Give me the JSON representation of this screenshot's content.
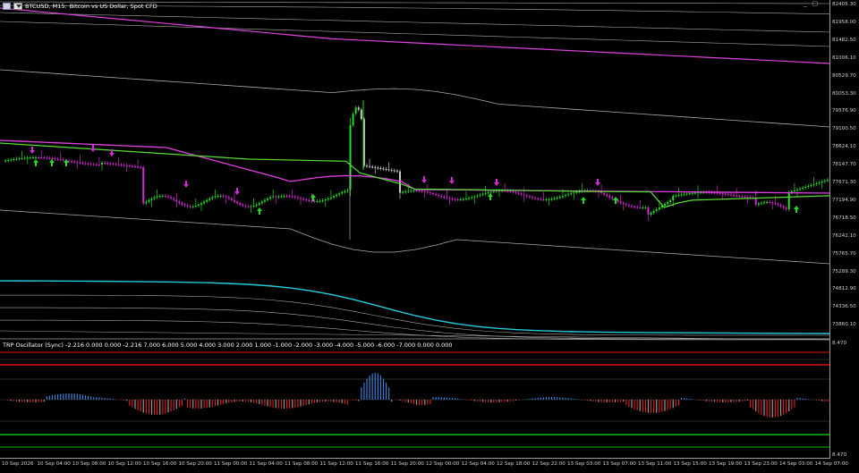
{
  "header": {
    "symbol_timeframe": "BTCUSD, M15:",
    "description": "Bitcoin vs US Dollar, Spot CFD"
  },
  "oscillator_header": {
    "text": "TRP Oscillator (Sync) -2.216 0.000 0.000 -2.216 7.000 6.000 5.000 4.000 3.000 2.000 1.000 -1.000 -2.000 -3.000 -4.000 -5.000 -6.000 -7.000 0.000 0.000"
  },
  "price_axis": [
    "82405.30",
    "81958.00",
    "81482.50",
    "81006.10",
    "80529.70",
    "80053.30",
    "79576.90",
    "79100.50",
    "78624.10",
    "78147.70",
    "77671.30",
    "77194.90",
    "76718.50",
    "76242.10",
    "75765.70",
    "75289.30",
    "74812.90",
    "74336.50",
    "73860.10"
  ],
  "osc_axis": [
    "8.470",
    "8.470"
  ],
  "time_axis": [
    "10 Sep 2026",
    "10 Sep 04:00",
    "10 Sep 08:00",
    "10 Sep 12:00",
    "10 Sep 16:00",
    "10 Sep 20:00",
    "11 Sep 00:00",
    "11 Sep 04:00",
    "11 Sep 08:00",
    "11 Sep 12:00",
    "11 Sep 16:00",
    "11 Sep 20:00",
    "12 Sep 00:00",
    "12 Sep 04:00",
    "12 Sep 18:00",
    "12 Sep 22:00",
    "13 Sep 03:00",
    "13 Sep 07:00",
    "13 Sep 11:00",
    "13 Sep 15:00",
    "13 Sep 19:00",
    "13 Sep 23:00",
    "14 Sep 03:00",
    "14 Sep 07:00"
  ],
  "window_controls": [
    "_",
    "▢"
  ],
  "colors": {
    "background": "#000000",
    "bull_candle": "#22dd22",
    "bear_candle": "#d42ad4",
    "neutral_candle": "#c8c8c8",
    "ma_magenta": "#e040e0",
    "ma_green": "#55dd33",
    "band_gray": "#aaaaaa",
    "band_cyan": "#22ccdd",
    "osc_blue": "#3b7fd9",
    "osc_red": "#d42020",
    "osc_gray": "#999999",
    "osc_level_red": "#dd1111",
    "osc_level_green": "#11bb11"
  },
  "icons": [
    "chart-window-icon",
    "dropdown-arrow-icon",
    "buy-arrow-icon",
    "sell-arrow-icon"
  ]
}
